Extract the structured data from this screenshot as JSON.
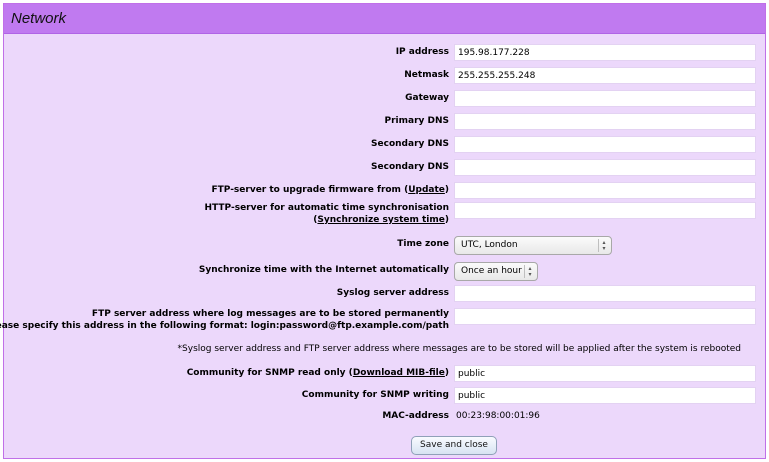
{
  "header": {
    "title": "Network"
  },
  "fields": {
    "ip_address": {
      "label": "IP address",
      "value": "195.98.177.228"
    },
    "netmask": {
      "label": "Netmask",
      "value": "255.255.255.248"
    },
    "gateway": {
      "label": "Gateway",
      "value": ""
    },
    "primary_dns": {
      "label": "Primary DNS",
      "value": ""
    },
    "secondary_dns_1": {
      "label": "Secondary DNS",
      "value": ""
    },
    "secondary_dns_2": {
      "label": "Secondary DNS",
      "value": ""
    },
    "ftp_firmware": {
      "label_prefix": "FTP-server to upgrade firmware from (",
      "link": "Update",
      "label_suffix": ")",
      "value": ""
    },
    "http_time": {
      "label_line1": "HTTP-server for automatic time synchronisation",
      "link_prefix": "(",
      "link": "Synchronize system time",
      "link_suffix": ")",
      "value": ""
    },
    "time_zone": {
      "label": "Time zone",
      "selected": "UTC, London"
    },
    "sync_time": {
      "label": "Synchronize time with the Internet automatically",
      "selected": "Once an hour"
    },
    "syslog": {
      "label": "Syslog server address",
      "value": ""
    },
    "ftp_log": {
      "label_line1": "FTP server address where log messages are to be stored permanently",
      "label_line2": "Please specify this address in the following format: login:password@ftp.example.com/path",
      "value": ""
    },
    "note": "*Syslog server address and FTP server address where messages are to be stored will be applied after the system is rebooted",
    "snmp_read": {
      "label_prefix": "Community for SNMP read only (",
      "link": "Download MIB-file",
      "label_suffix": ")",
      "value": "public"
    },
    "snmp_write": {
      "label": "Community for SNMP writing",
      "value": "public"
    },
    "mac": {
      "label": "MAC-address",
      "value": "00:23:98:00:01:96"
    }
  },
  "buttons": {
    "save_close": "Save and close"
  },
  "colors": {
    "header": "#c07af0",
    "panel": "#ecd8fb"
  }
}
